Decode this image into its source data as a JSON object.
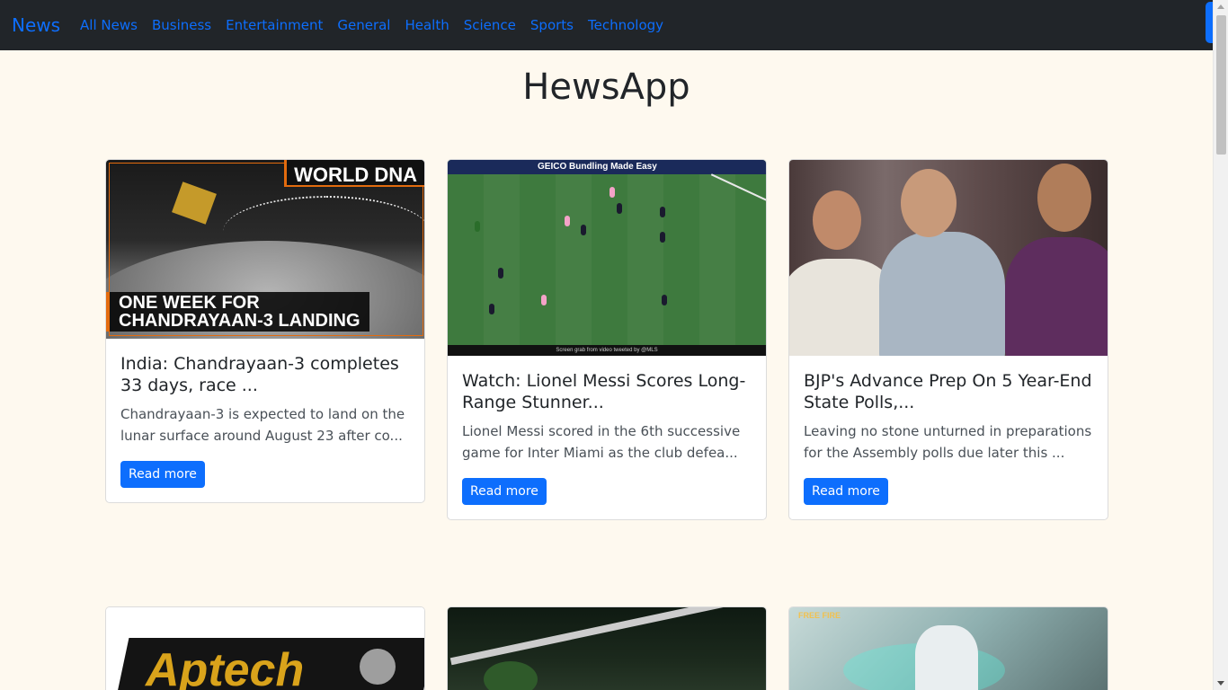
{
  "navbar": {
    "brand": "News",
    "links": [
      "All News",
      "Business",
      "Entertainment",
      "General",
      "Health",
      "Science",
      "Sports",
      "Technology"
    ]
  },
  "page": {
    "title": "HewsApp"
  },
  "articles": [
    {
      "image_overlay_tag": "WORLD DNA",
      "image_caption_line1": "ONE WEEK FOR",
      "image_caption_line2": "CHANDRAYAAN-3 LANDING",
      "title": "India: Chandrayaan-3 completes 33 days, race ...",
      "description": "Chandrayaan-3 is expected to land on the lunar surface around August 23 after co...",
      "button": "Read more"
    },
    {
      "image_board_text": "GEICO  Bundling Made Easy",
      "image_credit": "Screen grab from video tweeted by @MLS",
      "title": "Watch: Lionel Messi Scores Long-Range Stunner...",
      "description": "Lionel Messi scored in the 6th successive game for Inter Miami as the club defea...",
      "button": "Read more"
    },
    {
      "title": "BJP's Advance Prep On 5 Year-End State Polls,...",
      "description": "Leaving no stone unturned in preparations for the Assembly polls due later this ...",
      "button": "Read more"
    }
  ],
  "row2": {
    "img4_text": "Aptech",
    "img6_logo": "FREE FIRE"
  },
  "colors": {
    "navbar_bg": "#212529",
    "accent": "#0d6efd",
    "page_bg": "#fef9ef"
  }
}
